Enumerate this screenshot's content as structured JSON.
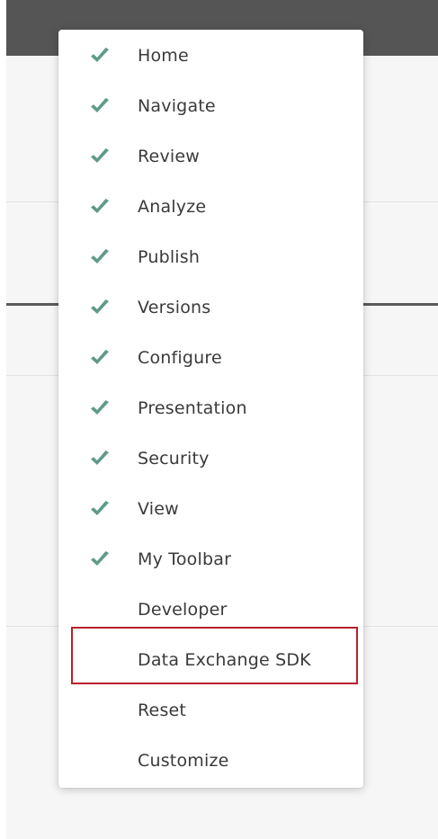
{
  "menu": {
    "items": [
      {
        "label": "Home",
        "checked": true
      },
      {
        "label": "Navigate",
        "checked": true
      },
      {
        "label": "Review",
        "checked": true
      },
      {
        "label": "Analyze",
        "checked": true
      },
      {
        "label": "Publish",
        "checked": true
      },
      {
        "label": "Versions",
        "checked": true
      },
      {
        "label": "Configure",
        "checked": true
      },
      {
        "label": "Presentation",
        "checked": true
      },
      {
        "label": "Security",
        "checked": true
      },
      {
        "label": "View",
        "checked": true
      },
      {
        "label": "My Toolbar",
        "checked": true
      },
      {
        "label": "Developer",
        "checked": false
      },
      {
        "label": "Data Exchange SDK",
        "checked": false
      },
      {
        "label": "Reset",
        "checked": false
      },
      {
        "label": "Customize",
        "checked": false
      }
    ],
    "highlighted_item": "Data Exchange SDK"
  },
  "icons": {
    "check": "checkmark-icon"
  },
  "colors": {
    "check": "#5f9a8a",
    "highlight_border": "#b8202b",
    "topbar": "#555555"
  }
}
